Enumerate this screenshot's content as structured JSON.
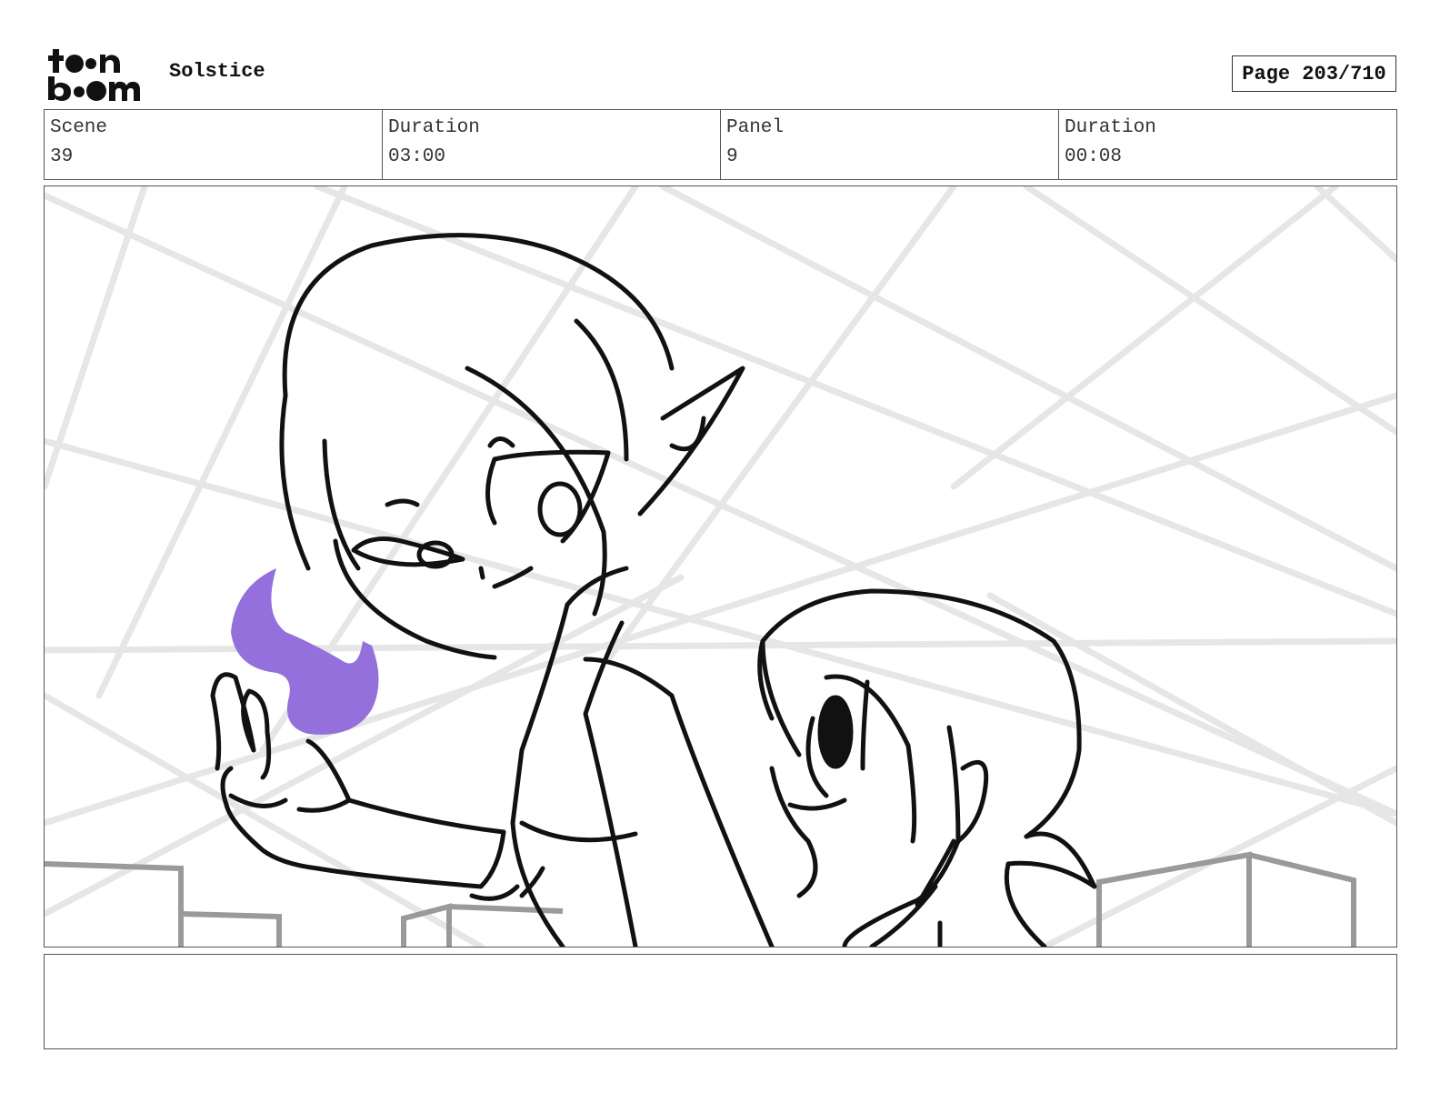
{
  "header": {
    "logo_name": "toon boom",
    "project_title": "Solstice",
    "page_label": "Page 203/710"
  },
  "info": {
    "scene_label": "Scene",
    "scene_value": "39",
    "scene_duration_label": "Duration",
    "scene_duration_value": "03:00",
    "panel_label": "Panel",
    "panel_value": "9",
    "panel_duration_label": "Duration",
    "panel_duration_value": "00:08"
  },
  "panel": {
    "image_kind": "storyboard-sketch",
    "flame_color": "#9370db",
    "grid_color": "#e6e6e6",
    "line_color": "#111111"
  },
  "notes": {
    "text": ""
  }
}
